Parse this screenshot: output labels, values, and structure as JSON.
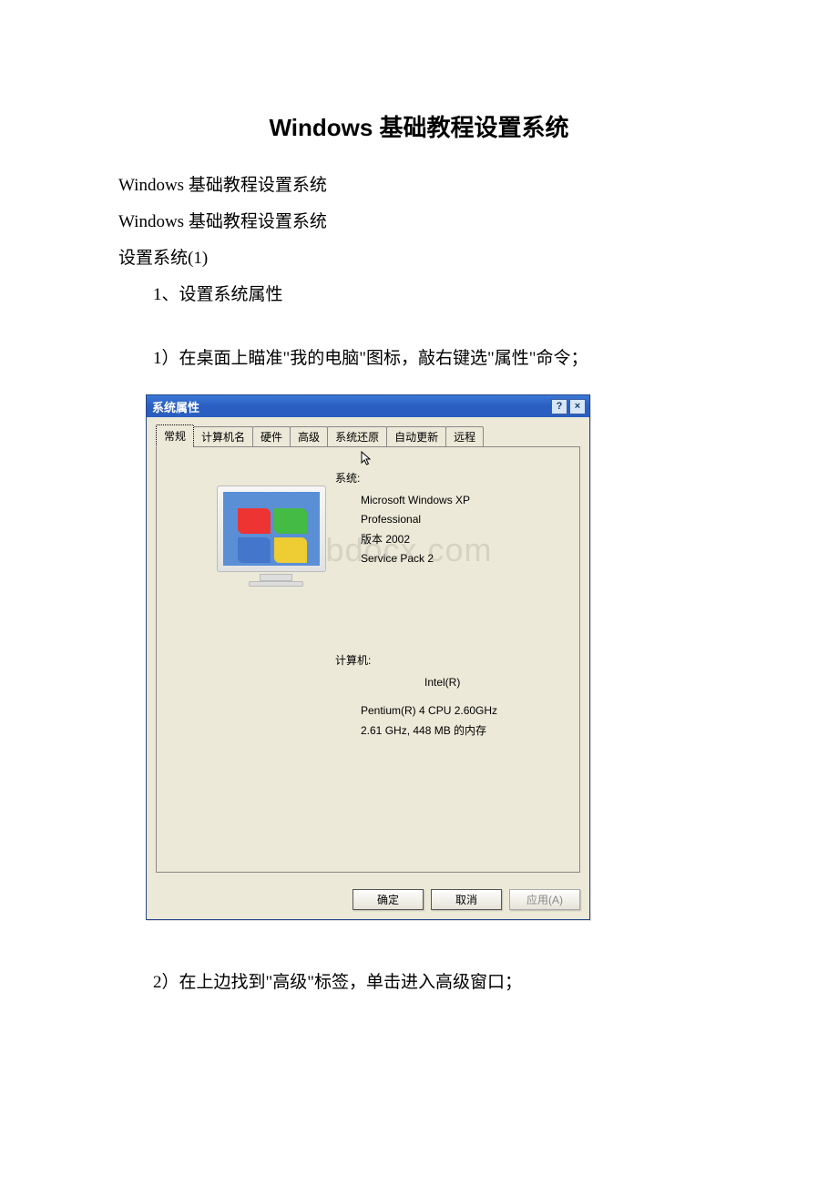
{
  "doc": {
    "title": "Windows 基础教程设置系统",
    "line1": "Windows 基础教程设置系统",
    "line2": "Windows 基础教程设置系统",
    "line3": "设置系统(1)",
    "step1": "1、设置系统属性",
    "step1_1": "1）在桌面上瞄准\"我的电脑\"图标，敲右键选\"属性\"命令；",
    "step1_2": "2）在上边找到\"高级\"标签，单击进入高级窗口；"
  },
  "dialog": {
    "title": "系统属性",
    "tabs": [
      "常规",
      "计算机名",
      "硬件",
      "高级",
      "系统还原",
      "自动更新",
      "远程"
    ],
    "active_tab_index": 0,
    "system_label": "系统:",
    "system_lines": {
      "l1": "Microsoft Windows XP",
      "l2": "Professional",
      "l3": "版本 2002",
      "l4": "Service Pack 2"
    },
    "computer_label": "计算机:",
    "computer_lines": {
      "l1": "Intel(R)",
      "l2": "Pentium(R) 4 CPU 2.60GHz",
      "l3": "2.61 GHz, 448 MB 的内存"
    },
    "buttons": {
      "ok": "确定",
      "cancel": "取消",
      "apply": "应用(A)"
    },
    "titlebar_help": "?",
    "titlebar_close": "×"
  },
  "watermark": "www.bdocx.com"
}
